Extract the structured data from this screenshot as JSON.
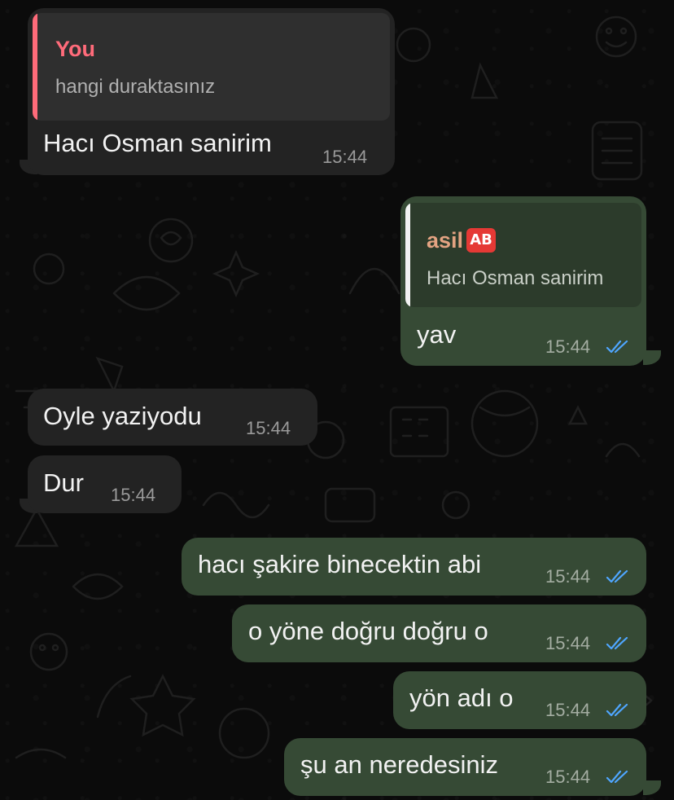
{
  "colors": {
    "background": "#0b0b0b",
    "incoming_bubble": "#232323",
    "outgoing_bubble": "#364a35",
    "quote_self_author": "#ff6b7a",
    "quote_other_author": "#e3a382",
    "read_ticks": "#4fa6ff"
  },
  "messages": [
    {
      "direction": "incoming",
      "reply": {
        "author": "You",
        "text": "hangi duraktasınız"
      },
      "text": "Hacı Osman sanirim",
      "time": "15:44"
    },
    {
      "direction": "outgoing",
      "reply": {
        "author": "asil",
        "badge": "AB",
        "text": "Hacı Osman sanirim"
      },
      "text": "yav",
      "time": "15:44",
      "status_icon": "double-check-read"
    },
    {
      "direction": "incoming",
      "text": "Oyle yaziyodu",
      "time": "15:44"
    },
    {
      "direction": "incoming",
      "text": "Dur",
      "time": "15:44"
    },
    {
      "direction": "outgoing",
      "text": "hacı şakire binecektin abi",
      "time": "15:44",
      "status_icon": "double-check-read"
    },
    {
      "direction": "outgoing",
      "text": "o yöne doğru doğru o",
      "time": "15:44",
      "status_icon": "double-check-read"
    },
    {
      "direction": "outgoing",
      "text": "yön adı o",
      "time": "15:44",
      "status_icon": "double-check-read"
    },
    {
      "direction": "outgoing",
      "text": "şu an neredesiniz",
      "time": "15:44",
      "status_icon": "double-check-read"
    }
  ]
}
